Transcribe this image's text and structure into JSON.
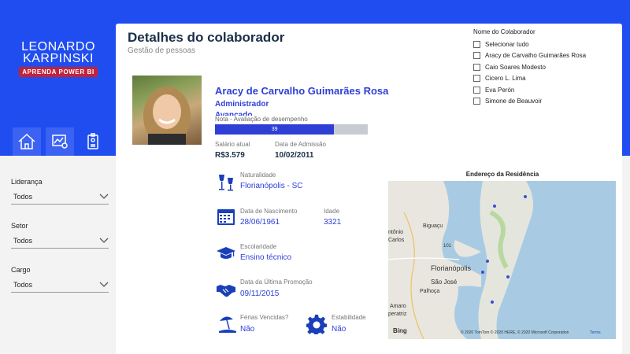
{
  "brand": {
    "line1": "LEONARDO",
    "line2": "KARPINSKI",
    "tagline": "APRENDA POWER BI"
  },
  "nav": {
    "items": [
      {
        "icon": "home-icon"
      },
      {
        "icon": "chart-icon"
      },
      {
        "icon": "badge-icon"
      }
    ]
  },
  "filters": {
    "lideranca_label": "Liderança",
    "lideranca_value": "Todos",
    "setor_label": "Setor",
    "setor_value": "Todos",
    "cargo_label": "Cargo",
    "cargo_value": "Todos"
  },
  "header": {
    "title": "Detalhes do colaborador",
    "subtitle": "Gestão de pessoas"
  },
  "employee": {
    "name": "Aracy de Carvalho Guimarães Rosa",
    "role": "Administrador",
    "level": "Avançado",
    "performance_label": "Nota - Avaliação de desempenho",
    "performance_value": "39",
    "performance_fraction": 0.78,
    "salary_label": "Salário atual",
    "salary_value": "R$3.579",
    "admission_label": "Data de Admissão",
    "admission_value": "10/02/2011",
    "origin_label": "Naturalidade",
    "origin_value": "Florianópolis - SC",
    "birth_label": "Data de Nascimento",
    "birth_value": "28/06/1961",
    "age_label": "Idade",
    "age_value": "3321",
    "education_label": "Escolaridade",
    "education_value": "Ensino técnico",
    "promotion_label": "Data da Última Promoção",
    "promotion_value": "09/11/2015",
    "vacation_label": "Férias Vencidas?",
    "vacation_value": "Não",
    "stability_label": "Estabilidade",
    "stability_value": "Não"
  },
  "map": {
    "title": "Endereço da Residência",
    "labels": {
      "biguacu": "Biguaçu",
      "antonio": "ntônio",
      "carlos": "Carlos",
      "florianopolis": "Florianópolis",
      "saojose": "São José",
      "palhoca": "Palhoça",
      "amaro": "Amaro",
      "peratriz": "peratriz",
      "road": "101"
    },
    "attribution": "© 2020 TomTom © 2020 HERE, © 2020 Microsoft Corporation",
    "terms": "Terms",
    "bing": "Bing"
  },
  "slicer": {
    "title": "Nome do Colaborador",
    "items": [
      "Selecionar tudo",
      "Aracy de Carvalho Guimarães Rosa",
      "Caio Soares Modesto",
      "Cicero L. Lima",
      "Eva Perón",
      "Simone de Beauvoir"
    ]
  },
  "colors": {
    "brand_blue": "#1f4df0",
    "accent_blue": "#2f3fd6",
    "tag_red": "#c0243a"
  }
}
